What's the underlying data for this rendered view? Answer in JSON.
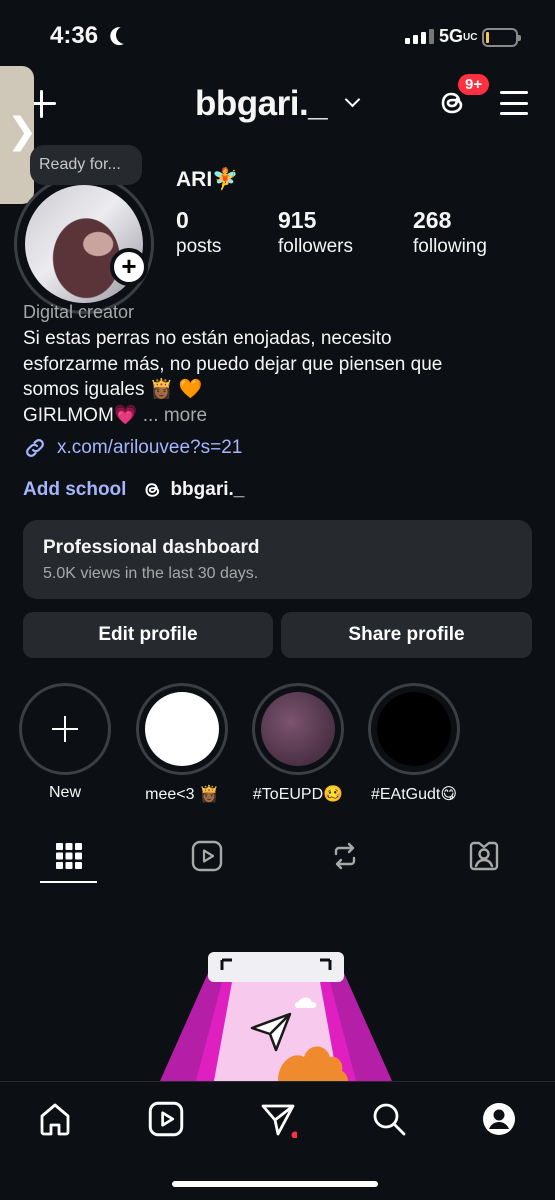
{
  "status_bar": {
    "time": "4:36",
    "network": "5G",
    "network_suffix": "UC",
    "battery_level": 0.1
  },
  "header": {
    "username": "bbgari._",
    "notification_badge": "9+"
  },
  "side_tab": {
    "glyph": "❯"
  },
  "profile": {
    "note": "Ready for...",
    "display_name": "ARI🧚",
    "stats": [
      {
        "value": "0",
        "label": "posts"
      },
      {
        "value": "915",
        "label": "followers"
      },
      {
        "value": "268",
        "label": "following"
      }
    ],
    "category": "Digital creator",
    "bio_lines": [
      "Si estas perras no están enojadas, necesito",
      "esforzarme más, no puedo dejar que piensen que",
      "somos iguales 👸🏾 🧡",
      "GIRLMOM💗"
    ],
    "more_label": "... more",
    "link": "x.com/arilouvee?s=21",
    "add_school": "Add school",
    "threads_handle": "bbgari._"
  },
  "dashboard": {
    "title": "Professional dashboard",
    "subtitle": "5.0K views in the last 30 days."
  },
  "buttons": {
    "edit_profile": "Edit profile",
    "share_profile": "Share profile"
  },
  "highlights": [
    {
      "label": "New",
      "type": "new"
    },
    {
      "label": "mee<3 👸🏾",
      "color": "#ffffff"
    },
    {
      "label": "#ToEUPD🥴",
      "color": "#5a3c52"
    },
    {
      "label": "#EAtGudt😋",
      "color": "#000000"
    }
  ],
  "tabs": [
    "grid-icon",
    "reels-icon",
    "reposts-icon",
    "tagged-icon"
  ],
  "bottom_nav": [
    "home-icon",
    "reels-icon",
    "send-icon",
    "search-icon",
    "profile-icon"
  ],
  "colors": {
    "background": "#0c1014",
    "card": "#262a2f",
    "link": "#a5b4fc",
    "badge": "#ff3040",
    "secondary_text": "#a8a8a8"
  }
}
